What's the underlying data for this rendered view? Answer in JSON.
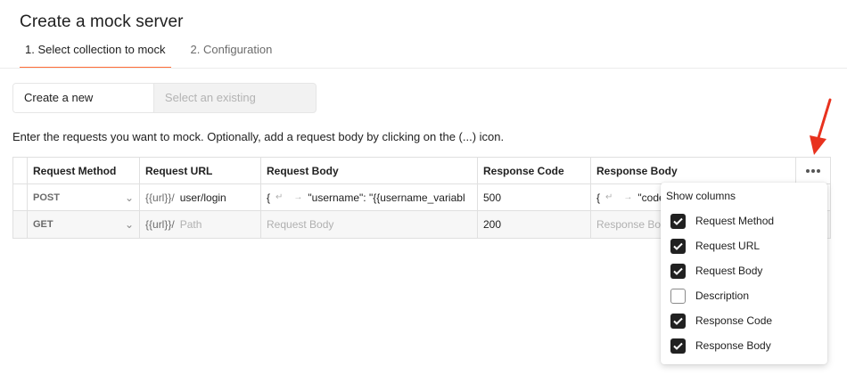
{
  "page": {
    "title": "Create a mock server"
  },
  "steps": [
    {
      "label": "1.  Select collection to mock",
      "active": true
    },
    {
      "label": "2.  Configuration",
      "active": false
    }
  ],
  "segmented": {
    "new_label": "Create a new collection",
    "existing_label": "Select an existing collection"
  },
  "hint": "Enter the requests you want to mock. Optionally, add a request body by clicking on the (...) icon.",
  "table": {
    "headers": [
      "Request Method",
      "Request URL",
      "Request Body",
      "Response Code",
      "Response Body"
    ],
    "url_prefix": "{{url}}/",
    "rows": [
      {
        "method": "POST",
        "url": "user/login",
        "request_body": "\"username\": \"{{username_variabl",
        "response_code": "500",
        "response_body": "\"code"
      },
      {
        "method": "GET",
        "url_placeholder": "Path",
        "request_body_placeholder": "Request Body",
        "response_code": "200",
        "response_body_placeholder": "Response Body"
      }
    ]
  },
  "columns_menu": {
    "title": "Show columns",
    "items": [
      {
        "label": "Request Method",
        "checked": true
      },
      {
        "label": "Request URL",
        "checked": true
      },
      {
        "label": "Request Body",
        "checked": true
      },
      {
        "label": "Description",
        "checked": false
      },
      {
        "label": "Response Code",
        "checked": true
      },
      {
        "label": "Response Body",
        "checked": true
      }
    ]
  },
  "colors": {
    "accent": "#ff6c37",
    "annotation_arrow": "#e8321e",
    "checkbox_on": "#212121"
  }
}
